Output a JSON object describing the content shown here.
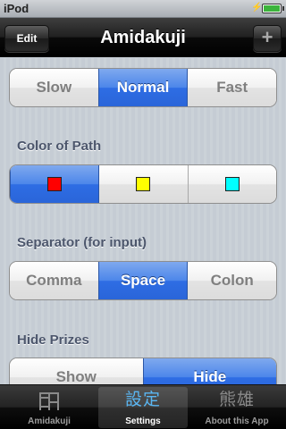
{
  "status_bar": {
    "carrier": "iPod",
    "time": ""
  },
  "nav": {
    "title": "Amidakuji",
    "edit_label": "Edit",
    "add_label": "+"
  },
  "sections": {
    "speed": {
      "options": [
        "Slow",
        "Normal",
        "Fast"
      ],
      "selected": "Normal"
    },
    "color": {
      "label": "Color of Path",
      "swatches": [
        "#ff0000",
        "#ffff00",
        "#00ffff"
      ],
      "selected_index": 0
    },
    "separator": {
      "label": "Separator (for input)",
      "options": [
        "Comma",
        "Space",
        "Colon"
      ],
      "selected": "Space"
    },
    "prizes": {
      "label": "Hide Prizes",
      "options": [
        "Show",
        "Hide"
      ],
      "selected": "Hide"
    }
  },
  "tabs": [
    {
      "icon": "amidakuji-ladder-icon",
      "label": "Amidakuji",
      "glyph": ""
    },
    {
      "icon": "settings-kanji-icon",
      "label": "Settings",
      "glyph": "設定"
    },
    {
      "icon": "about-kanji-icon",
      "label": "About this App",
      "glyph": "熊雄"
    }
  ],
  "colors": {
    "accent": "#2e6de4",
    "tab_active": "#5ab6f2",
    "section_label": "#4c566c"
  }
}
